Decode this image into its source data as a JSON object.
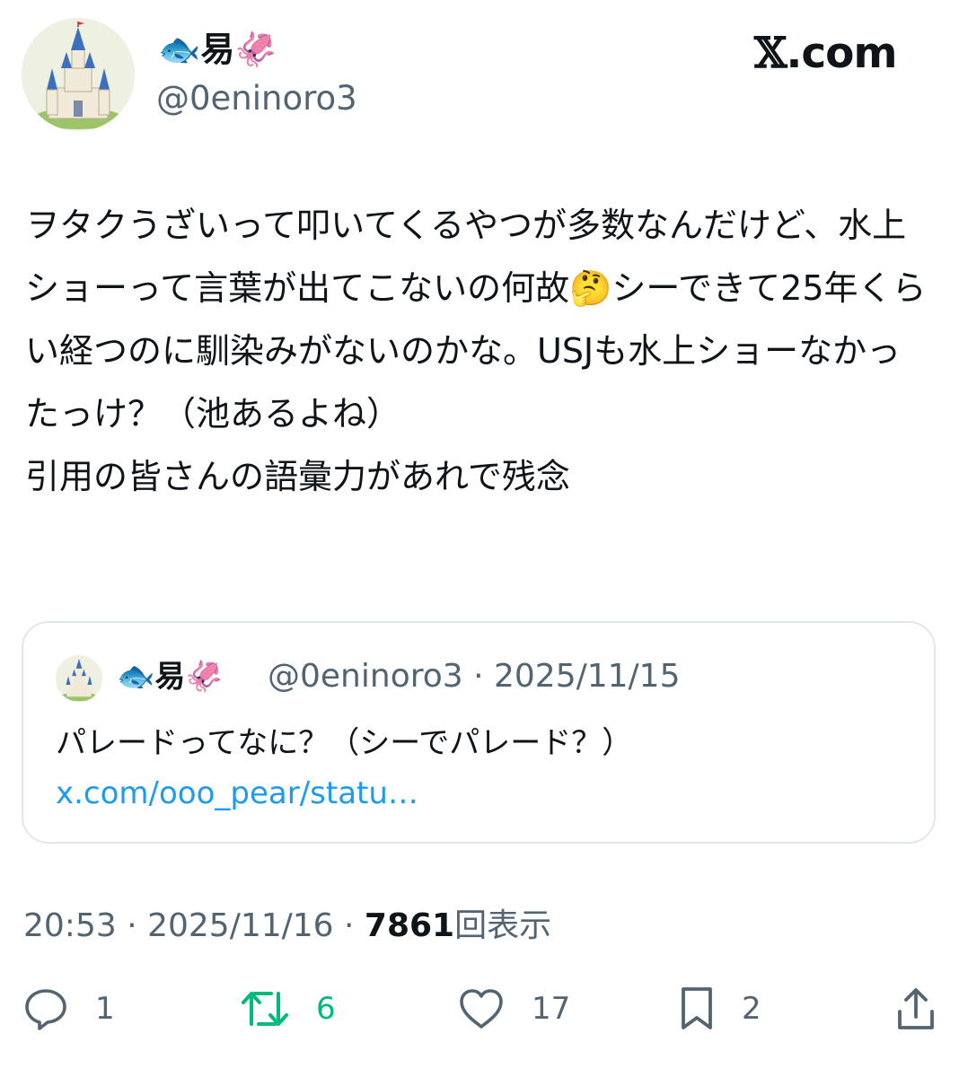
{
  "author": {
    "display_name": "🐟易🦑",
    "handle": "@0eninoro3"
  },
  "brand": {
    "x_mark": "𝕏",
    "domain": ".com"
  },
  "post": {
    "text": "ヲタクうざいって叩いてくるやつが多数なんだけど、水上ショーって言葉が出てこないの何故🤔シーできて25年くらい経つのに馴染みがないのかな。USJも水上ショーなかったっけ？（池あるよね）\n引用の皆さんの語彙力があれで残念"
  },
  "quoted": {
    "display_name": "🐟易🦑",
    "meta": "@0eninoro3 · 2025/11/15",
    "text": "パレードってなに？（シーでパレード？） ",
    "link": "x.com/ooo_pear/statu…"
  },
  "meta": {
    "time": "20:53 · 2025/11/16 · ",
    "views_count": "7861",
    "views_label": "回表示"
  },
  "actions": {
    "replies": "1",
    "reposts": "6",
    "likes": "17",
    "bookmarks": "2"
  },
  "colors": {
    "text": "#0f1419",
    "secondary": "#536471",
    "link": "#1d9bf0",
    "repost": "#00ba7c",
    "border": "#e1e8ed"
  }
}
